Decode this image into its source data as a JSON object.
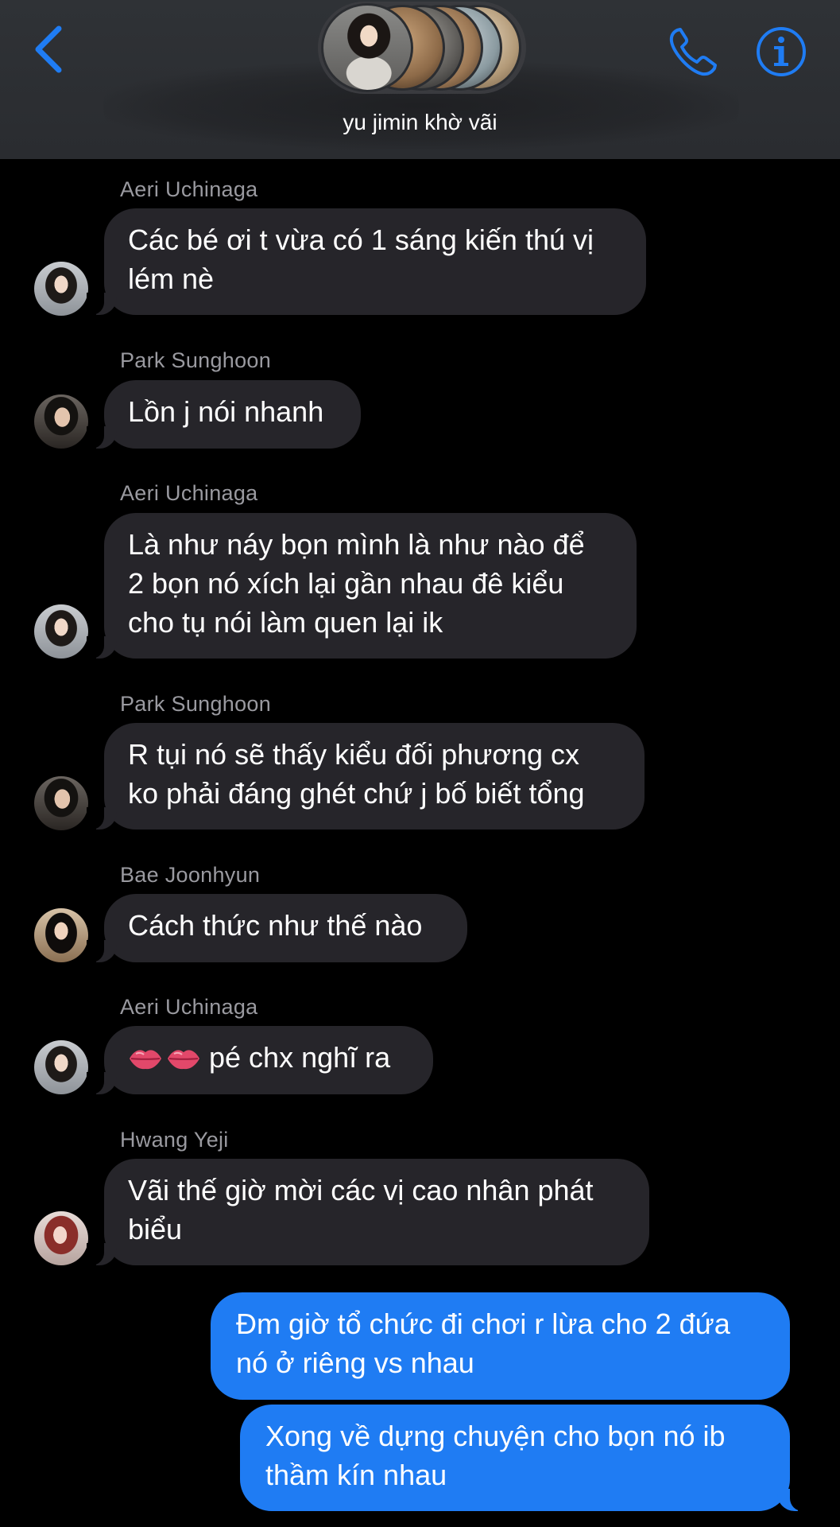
{
  "header": {
    "group_name": "yu jimin khờ vãi",
    "back_icon": "chevron-left-icon",
    "call_icon": "phone-icon",
    "info_icon": "info-icon",
    "accent_color": "#1f7cf3"
  },
  "messages": [
    {
      "sender": "Aeri Uchinaga",
      "lines": [
        "Các bé ơi t vừa có 1 sáng kiến thú vị",
        "lém nè"
      ]
    },
    {
      "sender": "Park Sunghoon",
      "lines": [
        "Lồn j nói nhanh"
      ]
    },
    {
      "sender": "Aeri Uchinaga",
      "lines": [
        "Là như náy bọn mình là như nào để",
        "2 bọn nó xích lại gần nhau đê kiểu",
        "cho tụ nói làm quen lại ik"
      ]
    },
    {
      "sender": "Park Sunghoon",
      "lines": [
        "R tụi nó sẽ thấy kiểu đối phương cx",
        "ko phải đáng ghét chứ j bố biết tổng"
      ]
    },
    {
      "sender": "Bae Joonhyun",
      "lines": [
        "Cách thức như thế nào"
      ]
    },
    {
      "sender": "Aeri Uchinaga",
      "emoji": "lips-icon",
      "text": "pé chx nghĩ ra"
    },
    {
      "sender": "Hwang Yeji",
      "lines": [
        "Vãi thế giờ mời các vị cao nhân phát",
        "biểu"
      ]
    }
  ],
  "my_messages": [
    {
      "lines": [
        "Đm giờ tổ chức đi chơi r lừa cho 2 đứa",
        "nó ở riêng vs nhau"
      ]
    },
    {
      "lines": [
        "Xong về dựng chuyện cho bọn nó ib",
        "thầm kín nhau"
      ]
    }
  ]
}
